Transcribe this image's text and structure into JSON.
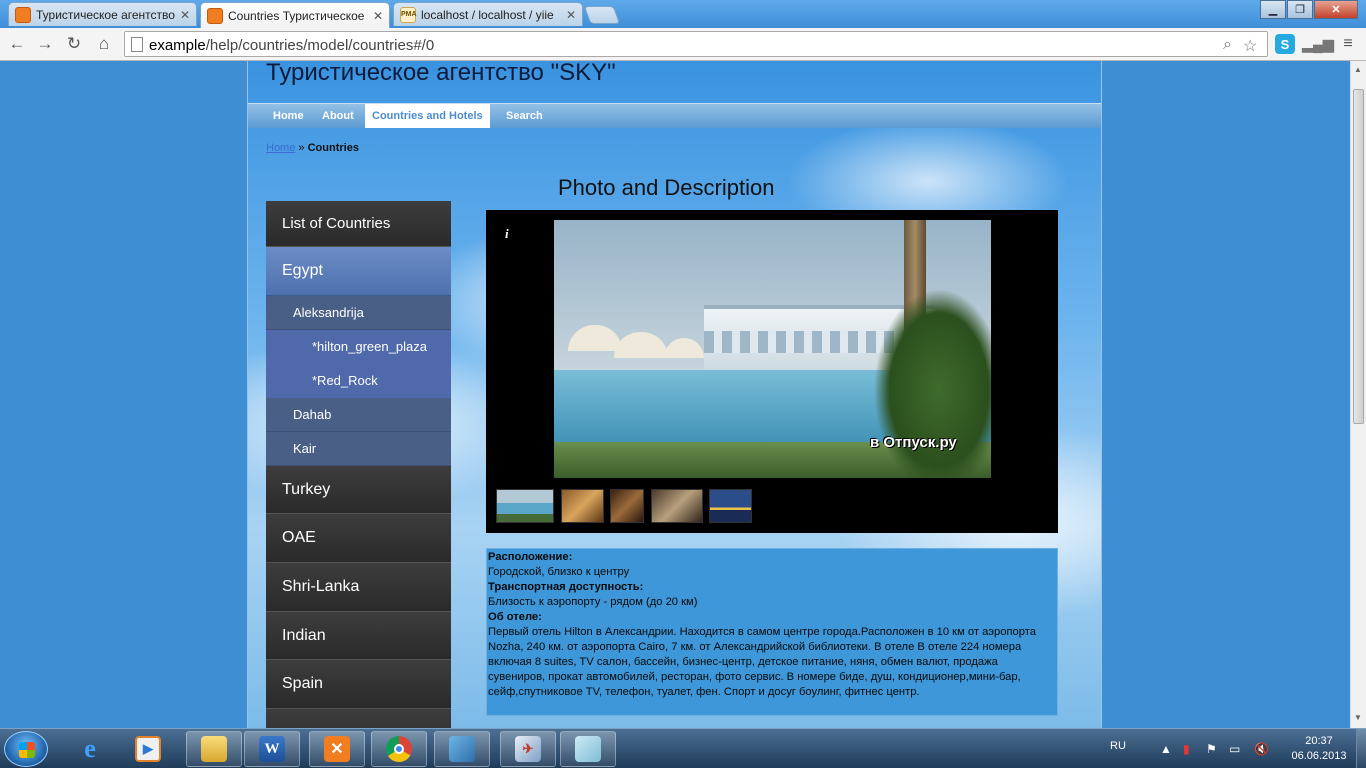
{
  "browser": {
    "tabs": [
      {
        "title": "Туристическое агентство",
        "icon": "xampp-icon",
        "active": false
      },
      {
        "title": "Countries Туристическое",
        "icon": "xampp-icon",
        "active": true
      },
      {
        "title": "localhost / localhost / yiie",
        "icon": "phpmyadmin-icon",
        "active": false
      }
    ],
    "url_host": "example",
    "url_path": "/help/countries/model/countries#/0"
  },
  "site": {
    "title": "Туристическое агентство \"SKY\"",
    "menu": [
      {
        "label": "Home",
        "active": false
      },
      {
        "label": "About",
        "active": false
      },
      {
        "label": "Countries and Hotels",
        "active": true
      },
      {
        "label": "Search",
        "active": false
      }
    ],
    "breadcrumb": {
      "home": "Home",
      "separator": "»",
      "current": "Countries"
    },
    "section_title": "Photo and Description"
  },
  "sidebar": {
    "header": "List of Countries",
    "items": [
      {
        "label": "Egypt",
        "level": 1,
        "selected": true
      },
      {
        "label": "Aleksandrija",
        "level": 2
      },
      {
        "label": "*hilton_green_plaza",
        "level": 3
      },
      {
        "label": "*Red_Rock",
        "level": 3
      },
      {
        "label": "Dahab",
        "level": 2
      },
      {
        "label": "Kair",
        "level": 2
      },
      {
        "label": "Turkey",
        "level": 1
      },
      {
        "label": "OAE",
        "level": 1
      },
      {
        "label": "Shri-Lanka",
        "level": 1
      },
      {
        "label": "Indian",
        "level": 1
      },
      {
        "label": "Spain",
        "level": 1
      }
    ]
  },
  "gallery": {
    "info_icon": "i",
    "watermark": "в Отпуск.ру",
    "thumbnails": 5
  },
  "description": {
    "location_label": "Расположение:",
    "location_value": "Городской, близко к центру",
    "transport_label": "Транспортная доступность:",
    "transport_value": "Близость к аэропорту - рядом (до 20 км)",
    "hotel_label": "Об отеле:",
    "hotel_value": "Первый отель Hilton в Александрии. Находится в самом центре города.Расположен в 10 км от аэропорта Nozha, 240 км. от аэропорта Cairo, 7 км. от Александрийской библиотеки. В отеле В отеле 224 номера включая 8 suites, TV салон, бассейн, бизнес-центр, детское питание, няня, обмен валют, продажа сувениров, прокат автомобилей, ресторан, фото сервис. В номере биде, душ, кондиционер,мини-бар, сейф,спутниковое TV, телефон, туалет, фен. Спорт и досуг боулинг, фитнес центр."
  },
  "taskbar": {
    "apps": [
      "ie-icon",
      "media-center-icon",
      "explorer-icon",
      "word-icon",
      "xampp-icon",
      "chrome-icon",
      "app-icon",
      "remote-icon",
      "note-icon"
    ],
    "language": "RU",
    "time": "20:37",
    "date": "06.06.2013"
  }
}
